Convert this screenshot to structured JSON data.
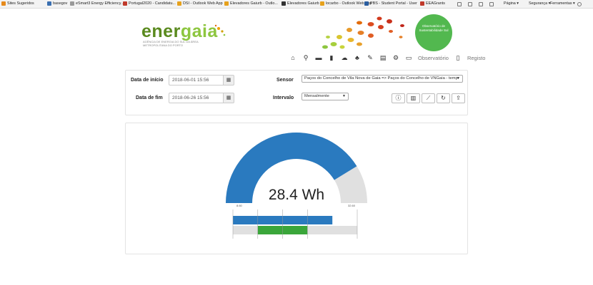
{
  "favorites": [
    {
      "label": "Sites Sugeridos",
      "color": "#e68a1c"
    },
    {
      "label": "basegov",
      "color": "#3a6fb0"
    },
    {
      "label": "eSmart3 Energy Efficiency...",
      "color": "#999999"
    },
    {
      "label": "Portugal2020 - Candidatu...",
      "color": "#c0392b"
    },
    {
      "label": "DSI - Outlook Web App",
      "color": "#e6a11c"
    },
    {
      "label": "Elevadores Gaiurb - Outlo...",
      "color": "#e6a11c"
    },
    {
      "label": "Elevadores Gaiurb",
      "color": "#333333"
    },
    {
      "label": "locarbo - Outlook Web App",
      "color": "#e6a11c"
    },
    {
      "label": "PBS - Student Portal - User",
      "color": "#2a5d9f"
    },
    {
      "label": "EEAGrants",
      "color": "#c0392b"
    }
  ],
  "browser_tools": [
    "Página",
    "Segurança",
    "Ferramentas"
  ],
  "logo": {
    "name_a": "ener",
    "name_b": "gaia",
    "subtitle": "AGÊNCIA DE ENERGIA DO SUL DA ÁREA METROPOLITANA DO PORTO"
  },
  "observatory": {
    "line1": "Observatório de",
    "line2": "Sustentabilidade Sul"
  },
  "nav": {
    "observatorio": "Observatório",
    "registo": "Registo"
  },
  "form": {
    "start_label": "Data de início",
    "start_value": "2018-06-01 15:56",
    "end_label": "Data de fim",
    "end_value": "2018-06-26 15:56",
    "sensor_label": "Sensor",
    "sensor_value": "Paços do Concelho de Vila Nova de Gaia => Paços do Concelho de VNGaia - temp",
    "interval_label": "Intervalo",
    "interval_value": "Mensalmente"
  },
  "gauge": {
    "value_text": "28.4 Wh",
    "min_label": "8.60",
    "max_label": "32.60",
    "min": 8.6,
    "max": 32.6,
    "value": 28.4,
    "bar_fraction": 0.8,
    "green_start": 0.2,
    "green_end": 0.6,
    "colors": {
      "primary": "#2a7abf",
      "track": "#e0e0e0",
      "green": "#3aa63a"
    }
  }
}
